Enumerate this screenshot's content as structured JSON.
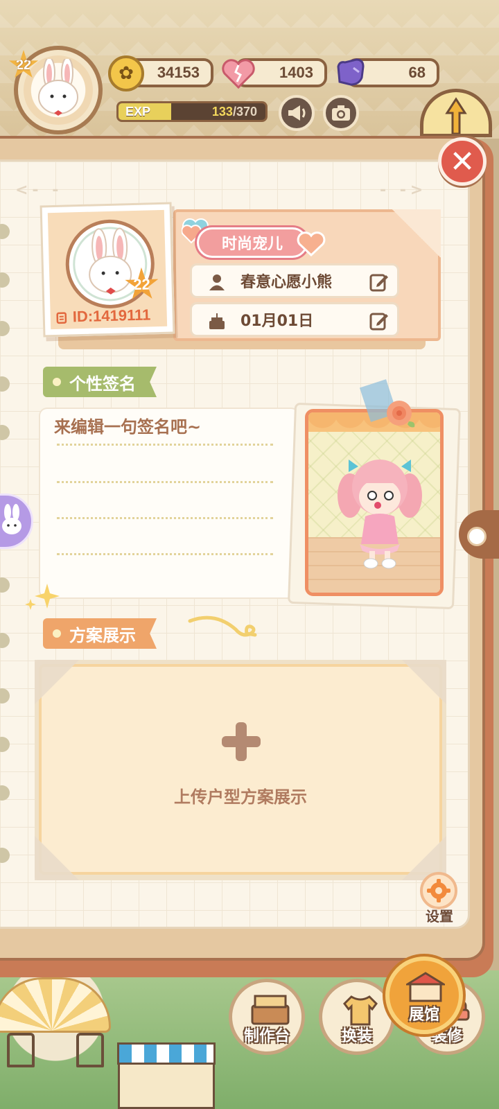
{
  "hud": {
    "player_level": "22",
    "coins": "34153",
    "hearts": "1403",
    "energy": "68",
    "exp_label": "EXP",
    "exp_current": "133",
    "exp_max": "/370",
    "exp_progress": 0.36,
    "icons": {
      "coin": "rabbit-coin-icon",
      "heart": "broken-heart-icon",
      "energy": "glove-icon",
      "announce": "megaphone-icon",
      "camera": "camera-icon"
    }
  },
  "profile": {
    "title_badge": "时尚宠儿",
    "avatar_level": "22",
    "id_text": "ID:1419111",
    "nickname": "春意心愿小熊",
    "birthday": "01月01日",
    "icons": {
      "nickname": "person-icon",
      "birthday": "cake-icon",
      "edit": "edit-icon",
      "copy": "copy-icon"
    }
  },
  "signature": {
    "section_title": "个性签名",
    "text": "来编辑一句签名吧~"
  },
  "plan": {
    "section_title": "方案展示",
    "upload_label": "上传户型方案展示"
  },
  "settings": {
    "label": "设置"
  },
  "bottom_nav": {
    "workbench": "制作台",
    "dressup": "换装",
    "renovate": "装修",
    "gallery": "展馆"
  },
  "colors": {
    "close": "#e05b4d",
    "signature_tag": "#a6bb6c",
    "plan_tag": "#efa56a",
    "title_badge": "#f29e9e",
    "panel": "#fbf5e9",
    "accent_brown": "#8a5a3e"
  }
}
